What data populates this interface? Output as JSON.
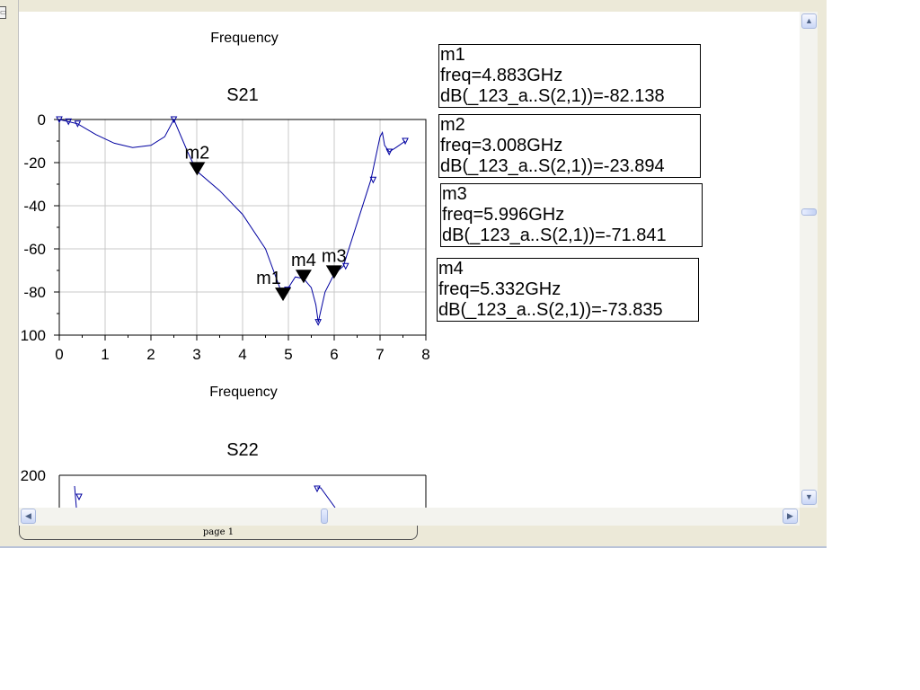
{
  "window": {
    "page_tab_label": "page 1"
  },
  "plots": {
    "top_partial_xlabel": "Frequency",
    "s21": {
      "title": "S21",
      "xlabel": "Frequency"
    },
    "s22": {
      "title": "S22",
      "visible_ytick": "200"
    }
  },
  "markers": [
    {
      "name": "m1",
      "freq": "freq=4.883GHz",
      "value": "dB(_123_a..S(2,1))=-82.138"
    },
    {
      "name": "m2",
      "freq": "freq=3.008GHz",
      "value": "dB(_123_a..S(2,1))=-23.894"
    },
    {
      "name": "m3",
      "freq": "freq=5.996GHz",
      "value": "dB(_123_a..S(2,1))=-71.841"
    },
    {
      "name": "m4",
      "freq": "freq=5.332GHz",
      "value": "dB(_123_a..S(2,1))=-73.835"
    }
  ],
  "chart_data": [
    {
      "type": "line",
      "title": "S21",
      "xlabel": "Frequency",
      "ylabel": "",
      "xlim": [
        0,
        8
      ],
      "ylim": [
        -100,
        0
      ],
      "xticks": [
        "0",
        "1",
        "2",
        "3",
        "4",
        "5",
        "6",
        "7",
        "8"
      ],
      "yticks": [
        "0",
        "-20",
        "-40",
        "-60",
        "-80",
        "100"
      ],
      "grid": true,
      "color": "#0000a0",
      "x": [
        0,
        0.2,
        0.4,
        0.8,
        1.2,
        1.6,
        2.0,
        2.3,
        2.5,
        2.8,
        3.0,
        3.5,
        4.0,
        4.5,
        4.883,
        5.0,
        5.15,
        5.332,
        5.5,
        5.6,
        5.65,
        5.8,
        5.996,
        6.2,
        6.5,
        6.8,
        7.0,
        7.05,
        7.1,
        7.2,
        7.35,
        7.55
      ],
      "y": [
        0,
        -1,
        -2,
        -7,
        -11,
        -13,
        -12,
        -8,
        0,
        -15,
        -23.9,
        -33,
        -44,
        -60,
        -82.1,
        -78,
        -73,
        -73.8,
        -78,
        -86,
        -94,
        -80,
        -71.8,
        -68,
        -48,
        -28,
        -8,
        -6,
        -12,
        -15,
        -13,
        -10
      ],
      "marker_points": [
        {
          "label": "m1",
          "x": 4.883,
          "y": -82.138
        },
        {
          "label": "m2",
          "x": 3.008,
          "y": -23.894
        },
        {
          "label": "m3",
          "x": 5.996,
          "y": -71.841
        },
        {
          "label": "m4",
          "x": 5.332,
          "y": -73.835
        }
      ]
    },
    {
      "type": "line",
      "title": "S22",
      "yticks": [
        "200"
      ],
      "grid": true,
      "color": "#0000a0"
    }
  ]
}
